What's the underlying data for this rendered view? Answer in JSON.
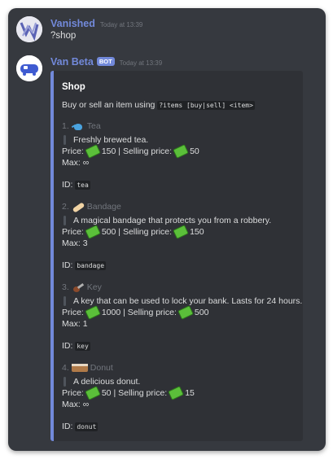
{
  "message1": {
    "username": "Vanished",
    "timestamp": "Today at 13:39",
    "content": "?shop"
  },
  "message2": {
    "username": "Van Beta",
    "badge": "BOT",
    "timestamp": "Today at 13:39"
  },
  "embed": {
    "title": "Shop",
    "desc_prefix": "Buy or sell an item using",
    "desc_code": "?items [buy|sell] <item>",
    "accent_color": "#7289da",
    "items": [
      {
        "num": "1.",
        "icon": "teapot-icon",
        "name": "Tea",
        "desc": "Freshly brewed tea.",
        "price_label": "Price:",
        "price": "150",
        "sell_label": "| Selling price:",
        "sell": "50",
        "max_label": "Max:",
        "max": "∞",
        "id_label": "ID:",
        "id": "tea"
      },
      {
        "num": "2.",
        "icon": "bandage-icon",
        "name": "Bandage",
        "desc": "A magical bandage that protects you from a robbery.",
        "price_label": "Price:",
        "price": "500",
        "sell_label": "| Selling price:",
        "sell": "150",
        "max_label": "Max:",
        "max": "3",
        "id_label": "ID:",
        "id": "bandage"
      },
      {
        "num": "3.",
        "icon": "key-icon",
        "name": "Key",
        "desc": "A key that can be used to lock your bank. Lasts for 24 hours.",
        "price_label": "Price:",
        "price": "1000",
        "sell_label": "| Selling price:",
        "sell": "500",
        "max_label": "Max:",
        "max": "1",
        "id_label": "ID:",
        "id": "key"
      },
      {
        "num": "4.",
        "icon": "donut-box-icon",
        "name": "Donut",
        "desc": "A delicious donut.",
        "price_label": "Price:",
        "price": "50",
        "sell_label": "| Selling price:",
        "sell": "15",
        "max_label": "Max:",
        "max": "∞",
        "id_label": "ID:",
        "id": "donut"
      }
    ]
  }
}
